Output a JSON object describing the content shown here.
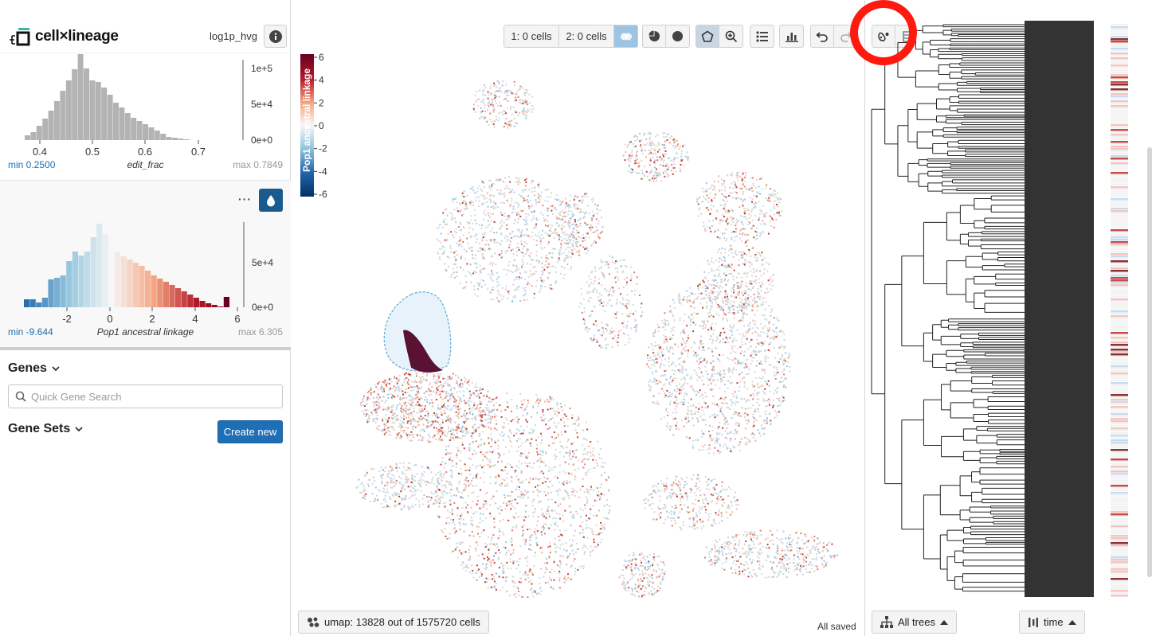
{
  "app": {
    "title": "cell×lineage",
    "layer": "log1p_hvg"
  },
  "histogram1": {
    "field": "edit_frac",
    "min_label": "min 0.2500",
    "max_label": "max 0.7849",
    "x_ticks": [
      "0.4",
      "0.5",
      "0.6",
      "0.7"
    ],
    "y_ticks": [
      "1e+5",
      "5e+4",
      "0e+0"
    ],
    "bar_color": "#b3b3b3"
  },
  "histogram2": {
    "field": "Pop1 ancestral linkage",
    "min_label": "min -9.644",
    "max_label": "max 6.305",
    "x_ticks": [
      "-2",
      "0",
      "2",
      "4",
      "6"
    ],
    "y_ticks": [
      "5e+4",
      "0e+0"
    ],
    "menu_label": "···"
  },
  "genes": {
    "title": "Genes",
    "search_placeholder": "Quick Gene Search"
  },
  "gene_sets": {
    "title": "Gene Sets",
    "create_label": "Create new"
  },
  "toolbar": {
    "cellset1": "1: 0 cells",
    "cellset2": "2: 0 cells"
  },
  "legend": {
    "title": "Pop1 ancestral linkage",
    "ticks": [
      "6",
      "4",
      "2",
      "0",
      "-2",
      "-4",
      "-6"
    ],
    "color_high": "#67001f",
    "color_mid": "#f7f7f7",
    "color_low": "#053061"
  },
  "embedding": {
    "label": "umap: 13828 out of 1575720 cells"
  },
  "status": {
    "saved": "All saved"
  },
  "tree_panel": {
    "trees_label": "All trees",
    "time_label": "time"
  },
  "colors": {
    "accent": "#1e6fb5",
    "highlight": "#ff1a0f"
  }
}
